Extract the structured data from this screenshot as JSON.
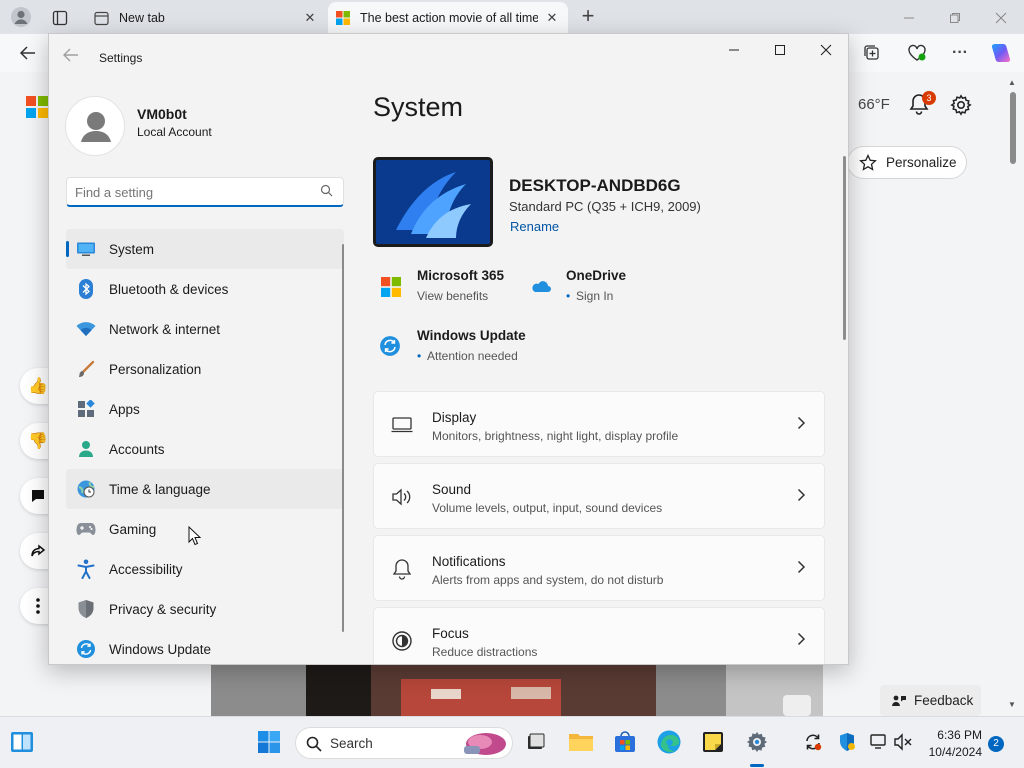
{
  "browser": {
    "tabs": [
      {
        "title": "New tab",
        "icon": "new-tab-page-icon"
      },
      {
        "title": "The best action movie of all time",
        "icon": "microsoft-logo-icon"
      }
    ],
    "close_glyph": "✕",
    "new_tab_glyph": "+",
    "weather": "66°F",
    "notification_count": "3",
    "personalize_label": "Personalize",
    "feedback_label": "Feedback"
  },
  "settings": {
    "window_title": "Settings",
    "profile": {
      "name": "VM0b0t",
      "account_type": "Local Account"
    },
    "search": {
      "placeholder": "Find a setting"
    },
    "nav": [
      {
        "label": "System",
        "icon": "system-icon",
        "selected": true
      },
      {
        "label": "Bluetooth & devices",
        "icon": "bluetooth-icon"
      },
      {
        "label": "Network & internet",
        "icon": "wifi-icon"
      },
      {
        "label": "Personalization",
        "icon": "brush-icon"
      },
      {
        "label": "Apps",
        "icon": "apps-icon"
      },
      {
        "label": "Accounts",
        "icon": "accounts-icon"
      },
      {
        "label": "Time & language",
        "icon": "globe-clock-icon",
        "hover": true
      },
      {
        "label": "Gaming",
        "icon": "gamepad-icon"
      },
      {
        "label": "Accessibility",
        "icon": "accessibility-icon"
      },
      {
        "label": "Privacy & security",
        "icon": "shield-icon"
      },
      {
        "label": "Windows Update",
        "icon": "windows-update-icon"
      }
    ],
    "page_title": "System",
    "device": {
      "name": "DESKTOP-ANDBD6G",
      "model": "Standard PC (Q35 + ICH9, 2009)",
      "rename_label": "Rename"
    },
    "tiles": {
      "m365": {
        "title": "Microsoft 365",
        "subtitle": "View benefits"
      },
      "onedrive": {
        "title": "OneDrive",
        "subtitle": "Sign In",
        "bullet": "•"
      },
      "update": {
        "title": "Windows Update",
        "subtitle": "Attention needed",
        "bullet": "•"
      }
    },
    "cards": [
      {
        "title": "Display",
        "subtitle": "Monitors, brightness, night light, display profile",
        "icon": "display-icon"
      },
      {
        "title": "Sound",
        "subtitle": "Volume levels, output, input, sound devices",
        "icon": "speaker-icon"
      },
      {
        "title": "Notifications",
        "subtitle": "Alerts from apps and system, do not disturb",
        "icon": "bell-icon"
      },
      {
        "title": "Focus",
        "subtitle": "Reduce distractions",
        "icon": "focus-icon"
      }
    ]
  },
  "taskbar": {
    "search_label": "Search",
    "time": "6:36 PM",
    "date": "10/4/2024",
    "notification_count": "2"
  },
  "colors": {
    "accent": "#0067c0",
    "badge": "#d83b01"
  }
}
